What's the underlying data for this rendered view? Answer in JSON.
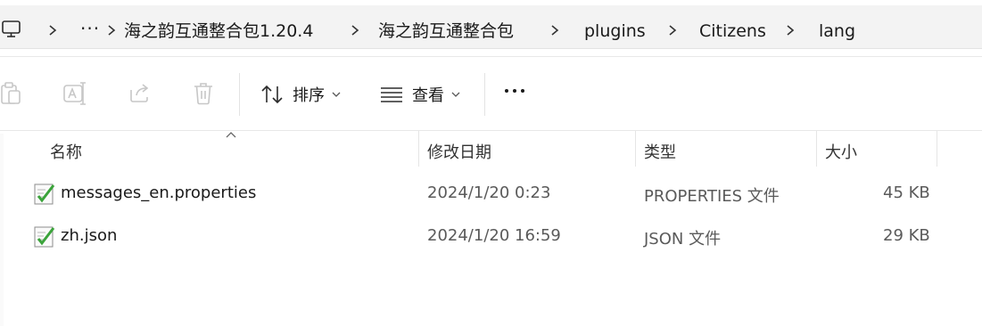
{
  "breadcrumb": {
    "overflow_label": "···",
    "items": [
      "海之韵互通整合包1.20.4",
      "海之韵互通整合包",
      "plugins",
      "Citizens",
      "lang"
    ]
  },
  "toolbar": {
    "sort_label": "排序",
    "view_label": "查看"
  },
  "columns": {
    "name": "名称",
    "date": "修改日期",
    "type": "类型",
    "size": "大小"
  },
  "files": [
    {
      "name": "messages_en.properties",
      "date": "2024/1/20 0:23",
      "type": "PROPERTIES 文件",
      "size": "45 KB"
    },
    {
      "name": "zh.json",
      "date": "2024/1/20 16:59",
      "type": "JSON 文件",
      "size": "29 KB"
    }
  ],
  "colors": {
    "accent": "#0067c0",
    "icon_green": "#3aa33a",
    "disabled_icon": "#c7c7c7"
  }
}
